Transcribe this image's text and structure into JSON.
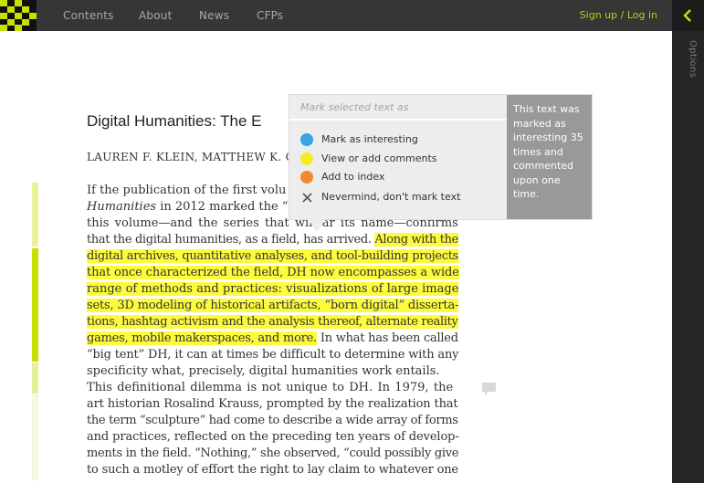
{
  "nav": {
    "items": [
      "Contents",
      "About",
      "News",
      "CFPs"
    ],
    "signup": "Sign up / Log in"
  },
  "sidebar": {
    "options_label": "Options",
    "toggle_icon": "chevron-left-icon"
  },
  "colors": {
    "highlight": "#fdfb3c",
    "accent": "#c8e000",
    "interesting": "#3aa3e8",
    "comments": "#f4ec26",
    "index": "#f08a2c"
  },
  "article": {
    "title": "Digital Humanities: The E",
    "authors": "LAUREN F. KLEIN, MATTHEW K. G",
    "lines": [
      {
        "parts": [
          {
            "t": "If the publication of the first volu",
            "s": ""
          }
        ]
      },
      {
        "parts": [
          {
            "t": "Humanities",
            "s": "it"
          },
          {
            "t": " in 2012 marked the “",
            "s": ""
          }
        ]
      },
      {
        "parts": [
          {
            "t": "this volume—and the series that will ",
            "s": ""
          },
          {
            "t": "ar its name—confirms",
            "s": ""
          }
        ]
      },
      {
        "parts": [
          {
            "t": "that the digital humanities, as a field, has arrived. ",
            "s": ""
          },
          {
            "t": "Along with the",
            "s": "hl"
          }
        ]
      },
      {
        "parts": [
          {
            "t": "digital archives, quantitative analyses, and tool-building projects",
            "s": "hl"
          }
        ]
      },
      {
        "parts": [
          {
            "t": "that once characterized the field, DH now encompasses a wide",
            "s": "hl"
          }
        ]
      },
      {
        "parts": [
          {
            "t": "range of methods and practices: visualizations of large image",
            "s": "hl"
          }
        ]
      },
      {
        "parts": [
          {
            "t": "sets, 3D modeling of historical artifacts, “born digital” disserta-",
            "s": "hl"
          }
        ]
      },
      {
        "parts": [
          {
            "t": "tions, hashtag activism and the analysis thereof, alternate reality",
            "s": "hl"
          }
        ]
      },
      {
        "parts": [
          {
            "t": "games, mobile makerspaces, and more.",
            "s": "hl"
          },
          {
            "t": " In what has been called",
            "s": ""
          }
        ]
      },
      {
        "parts": [
          {
            "t": "“big tent” DH, it can at times be difficult to determine with any",
            "s": ""
          }
        ]
      },
      {
        "parts": [
          {
            "t": "specificity what, precisely, digital humanities work entails.",
            "s": ""
          }
        ]
      },
      {
        "parts": [
          {
            "t": "     This definitional dilemma is not unique to DH. In 1979, the",
            "s": ""
          }
        ]
      },
      {
        "parts": [
          {
            "t": "art historian Rosalind Krauss, prompted by the realization that",
            "s": ""
          }
        ]
      },
      {
        "parts": [
          {
            "t": "the term “sculpture” had come to describe a wide array of forms",
            "s": ""
          }
        ]
      },
      {
        "parts": [
          {
            "t": "and practices, reflected on the preceding ten years of develop-",
            "s": ""
          }
        ]
      },
      {
        "parts": [
          {
            "t": "ments in the field. “Nothing,” she observed, “could possibly give",
            "s": ""
          }
        ]
      },
      {
        "parts": [
          {
            "t": "to such a motley of effort the right to lay claim to whatever one",
            "s": ""
          }
        ]
      }
    ]
  },
  "popup": {
    "header": "Mark selected text as",
    "options": [
      {
        "label": "Mark as interesting",
        "icon": "blue-dot-icon"
      },
      {
        "label": "View or add comments",
        "icon": "yellow-dot-icon"
      },
      {
        "label": "Add to index",
        "icon": "orange-dot-icon"
      },
      {
        "label": "Nevermind, don't mark text",
        "icon": "close-icon"
      }
    ],
    "note": "This text was marked as interesting 35 times and commented upon one time."
  }
}
